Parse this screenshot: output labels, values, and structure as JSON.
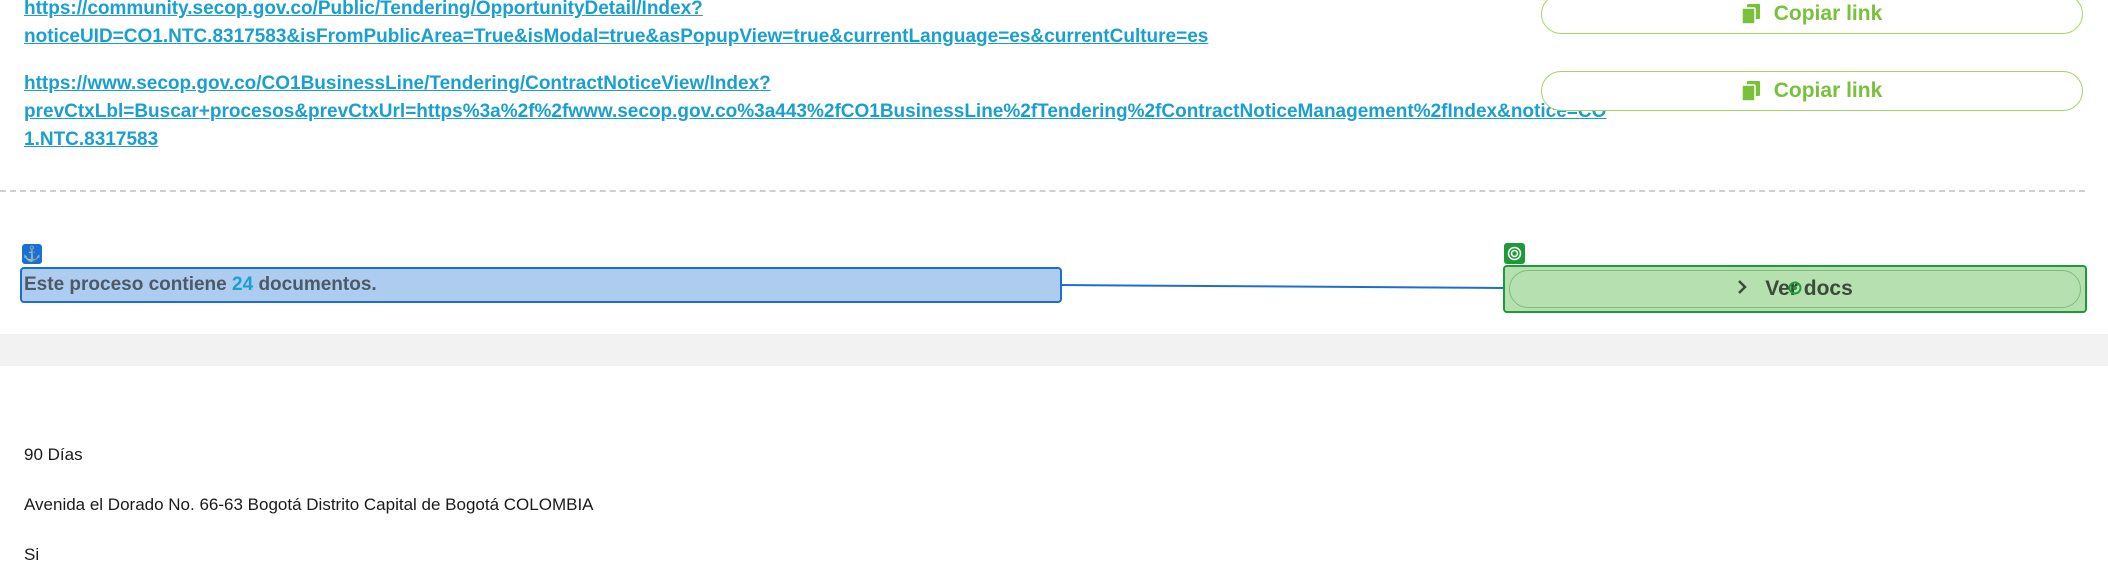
{
  "links": {
    "link1_line1": "https://community.secop.gov.co/Public/Tendering/OpportunityDetail/Index?",
    "link1_line2": "noticeUID=CO1.NTC.8317583&isFromPublicArea=True&isModal=true&asPopupView=true&currentLanguage=es&currentCulture=es",
    "link2_line1": "https://www.secop.gov.co/CO1BusinessLine/Tendering/ContractNoticeView/Index?",
    "link2_line2": "prevCtxLbl=Buscar+procesos&prevCtxUrl=https%3a%2f%2fwww.secop.gov.co%3a443%2fCO1BusinessLine%2fTendering%2fContractNoticeManagement%2fIndex&notice=CO",
    "link2_line3": "1.NTC.8317583"
  },
  "copy_button_label": "Copiar link",
  "documents": {
    "prefix": "Este proceso contiene",
    "count": "24",
    "suffix": "documentos."
  },
  "ver_docs_label": "Ver docs",
  "info": {
    "duration": "90 Días",
    "address": "Avenida el Dorado No. 66-63 Bogotá Distrito Capital de Bogotá COLOMBIA",
    "answer": "Si"
  },
  "colors": {
    "link": "#1a9fd0",
    "accent_green": "#79c13b",
    "annotation_blue": "#1c6fd1",
    "annotation_green": "#1e9a3a"
  }
}
